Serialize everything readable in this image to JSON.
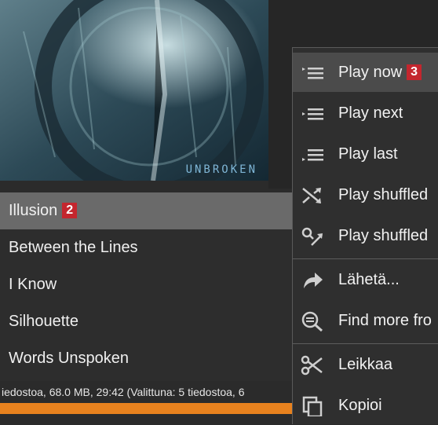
{
  "album": {
    "cover_text": "UNBROKEN"
  },
  "tracks": [
    {
      "title": "Illusion",
      "badge": "2"
    },
    {
      "title": "Between the Lines"
    },
    {
      "title": "I Know"
    },
    {
      "title": "Silhouette"
    },
    {
      "title": "Words Unspoken"
    }
  ],
  "status_bar": {
    "text": "iedostoa, 68.0 MB, 29:42 (Valittuna: 5 tiedostoa, 6"
  },
  "context_menu": {
    "items": [
      {
        "label": "Play now",
        "badge": "3",
        "icon": "play-now-icon"
      },
      {
        "label": "Play next",
        "icon": "play-next-icon"
      },
      {
        "label": "Play last",
        "icon": "play-last-icon"
      },
      {
        "label": "Play shuffled",
        "icon": "shuffle-icon"
      },
      {
        "label": "Play shuffled",
        "icon": "shuffle-search-icon"
      },
      {
        "label": "Lähetä...",
        "icon": "send-arrow-icon"
      },
      {
        "label": "Find more fro",
        "icon": "magnifier-icon"
      },
      {
        "label": "Leikkaa",
        "icon": "scissors-icon"
      },
      {
        "label": "Kopioi",
        "icon": "copy-icon"
      }
    ]
  },
  "colors": {
    "accent_orange": "#e8821e",
    "badge_red": "#c4262e",
    "selected_row": "#6a6a6a"
  }
}
